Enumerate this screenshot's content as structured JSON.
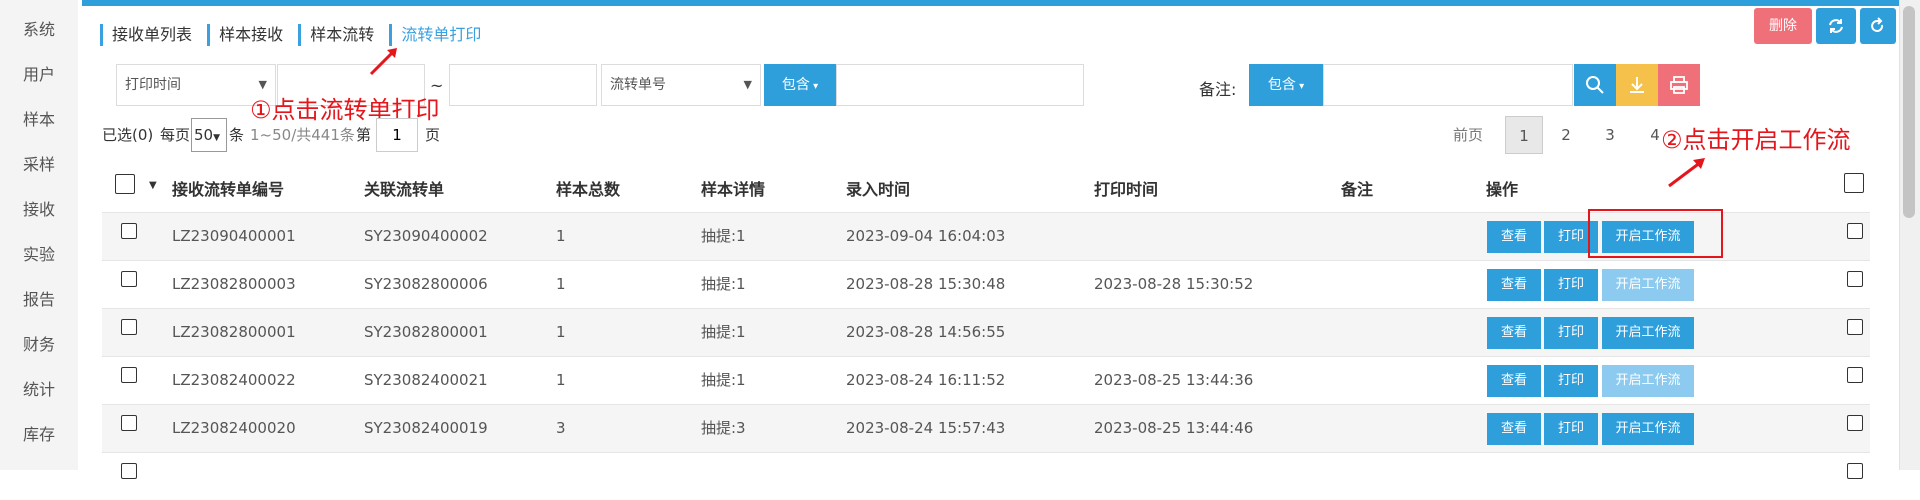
{
  "sidebar": {
    "items": [
      "系统",
      "用户",
      "样本",
      "采样",
      "接收",
      "实验",
      "报告",
      "财务",
      "统计",
      "库存"
    ]
  },
  "tabs": [
    {
      "label": "接收单列表",
      "active": false
    },
    {
      "label": "样本接收",
      "active": false
    },
    {
      "label": "样本流转",
      "active": false
    },
    {
      "label": "流转单打印",
      "active": true
    }
  ],
  "toolbar": {
    "delete_label": "删除"
  },
  "filters": {
    "date_field": "打印时间",
    "range_sep": "~",
    "field2": "流转单号",
    "match_mode": "包含",
    "remark_label": "备注:",
    "remark_match": "包含"
  },
  "annotations": {
    "a1": "①点击流转单打印",
    "a2": "②点击开启工作流"
  },
  "pager": {
    "selected": "已选(0)",
    "per_page_label": "每页",
    "per_page": "50",
    "per_page_suffix": "条",
    "range": "1~50/共441条",
    "page_prefix": "第",
    "page_value": "1",
    "page_suffix": "页",
    "prev": "前页",
    "pages": [
      "1",
      "2",
      "3",
      "4"
    ]
  },
  "table": {
    "headers": [
      "接收流转单编号",
      "关联流转单",
      "样本总数",
      "样本详情",
      "录入时间",
      "打印时间",
      "备注",
      "操作"
    ],
    "rows": [
      [
        "LZ23090400001",
        "SY23090400002",
        "1",
        "抽提:1",
        "2023-09-04 16:04:03",
        "",
        ""
      ],
      [
        "LZ23082800003",
        "SY23082800006",
        "1",
        "抽提:1",
        "2023-08-28 15:30:48",
        "2023-08-28 15:30:52",
        ""
      ],
      [
        "LZ23082800001",
        "SY23082800001",
        "1",
        "抽提:1",
        "2023-08-28 14:56:55",
        "",
        ""
      ],
      [
        "LZ23082400022",
        "SY23082400021",
        "1",
        "抽提:1",
        "2023-08-24 16:11:52",
        "2023-08-25 13:44:36",
        ""
      ],
      [
        "LZ23082400020",
        "SY23082400019",
        "3",
        "抽提:3",
        "2023-08-24 15:57:43",
        "2023-08-25 13:44:46",
        ""
      ]
    ],
    "workflow_enabled": [
      true,
      false,
      true,
      false,
      true
    ],
    "view_label": "查看",
    "print_label": "打印",
    "workflow_label": "开启工作流"
  },
  "colors": {
    "accent": "#2f9fdc",
    "danger": "#f0707a",
    "warning": "#f6c14a",
    "annotation": "#e4161c"
  }
}
